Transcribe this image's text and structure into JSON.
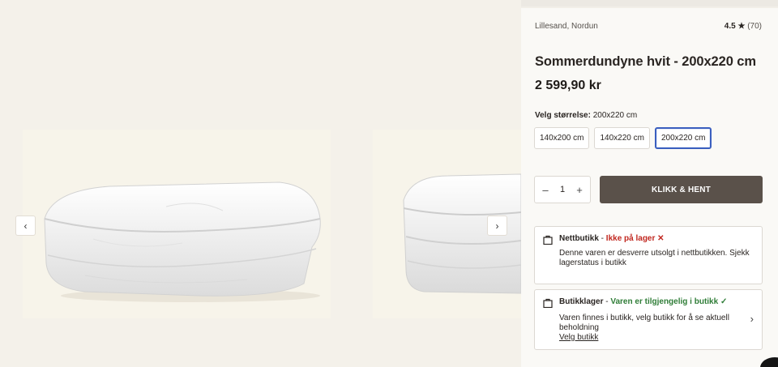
{
  "gallery": {
    "prev_arrow": "‹",
    "next_arrow": "›",
    "images": [
      "duvet-front-image",
      "duvet-side-image"
    ]
  },
  "product": {
    "location": "Lillesand, Nordun",
    "rating_score": "4.5 ★",
    "rating_count": "(70)",
    "title": "Sommerdundyne hvit - 200x220 cm",
    "price": "2 599,90 kr"
  },
  "size": {
    "label": "Velg størrelse:",
    "selected": "200x220 cm",
    "options": [
      "140x200 cm",
      "140x220 cm",
      "200x220 cm"
    ]
  },
  "cart": {
    "minus": "–",
    "quantity": "1",
    "plus": "+",
    "cta_label": "KLIKK & HENT"
  },
  "stock_online": {
    "name": "Nettbutikk",
    "separator": " - ",
    "status": "Ikke på lager",
    "status_icon": "✕",
    "description": "Denne varen er desverre utsolgt i nettbutikken. Sjekk lagerstatus i butikk"
  },
  "stock_store": {
    "name": "Butikklager",
    "separator": " - ",
    "status": "Varen er tilgjengelig i butikk",
    "status_icon": "✓",
    "description": "Varen finnes i butikk, velg butikk for å se aktuell beholdning",
    "link": "Velg butikk",
    "chevron": "›"
  },
  "colors": {
    "cta_bg": "#5a514a",
    "selected_border": "#3b5fbf",
    "out_of_stock": "#c1271f",
    "in_stock": "#2f7d37"
  }
}
